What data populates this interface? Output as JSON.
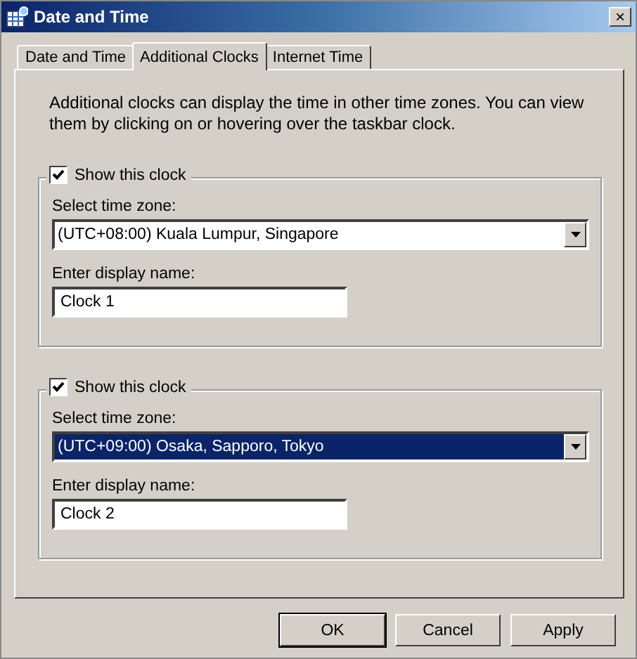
{
  "window": {
    "title": "Date and Time",
    "close": "×"
  },
  "tabs": [
    {
      "label": "Date and Time",
      "selected": false
    },
    {
      "label": "Additional Clocks",
      "selected": true
    },
    {
      "label": "Internet Time",
      "selected": false
    }
  ],
  "description": "Additional clocks can display the time in other time zones. You can view them by clicking on or hovering over the taskbar clock.",
  "clocks": [
    {
      "show_label": "Show this clock",
      "checked": true,
      "zone_label": "Select time zone:",
      "zone": "(UTC+08:00) Kuala Lumpur, Singapore",
      "zone_selected": false,
      "name_label": "Enter display name:",
      "name": "Clock 1"
    },
    {
      "show_label": "Show this clock",
      "checked": true,
      "zone_label": "Select time zone:",
      "zone": "(UTC+09:00) Osaka, Sapporo, Tokyo",
      "zone_selected": true,
      "name_label": "Enter display name:",
      "name": "Clock 2"
    }
  ],
  "buttons": [
    {
      "label": "OK",
      "default": true
    },
    {
      "label": "Cancel",
      "default": false
    },
    {
      "label": "Apply",
      "default": false
    }
  ]
}
